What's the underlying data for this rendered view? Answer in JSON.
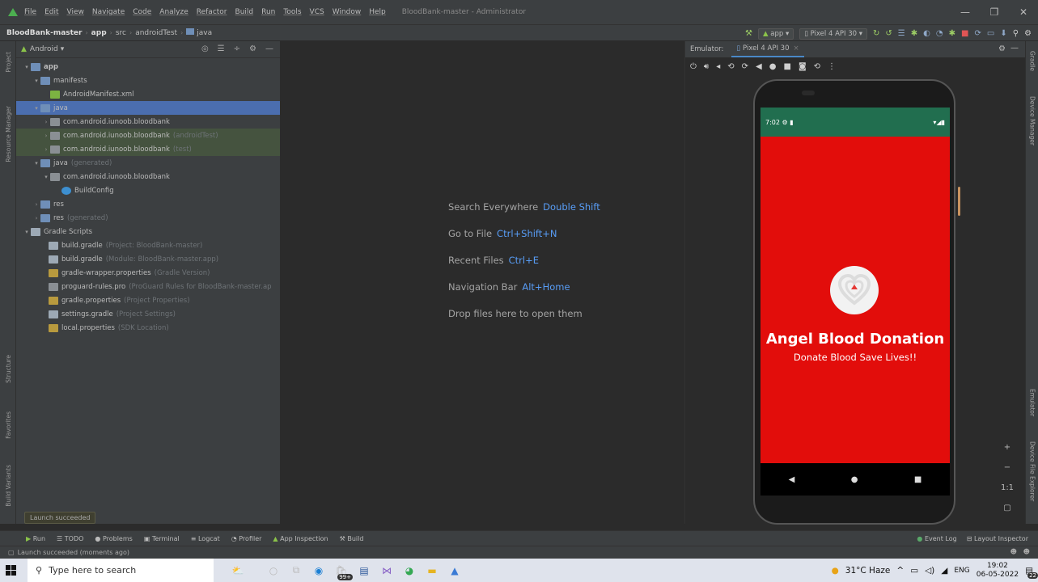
{
  "menubar": {
    "items": [
      "File",
      "Edit",
      "View",
      "Navigate",
      "Code",
      "Analyze",
      "Refactor",
      "Build",
      "Run",
      "Tools",
      "VCS",
      "Window",
      "Help"
    ],
    "window_title": "BloodBank-master - Administrator",
    "controls": [
      "—",
      "❐",
      "✕"
    ]
  },
  "navbar": {
    "breadcrumbs": [
      "BloodBank-master",
      "app",
      "src",
      "androidTest",
      "java"
    ],
    "run_config": "app",
    "device": "Pixel 4 API 30"
  },
  "sidebar_left": {
    "tabs": [
      "Project",
      "Resource Manager",
      "Structure",
      "Favorites",
      "Build Variants"
    ]
  },
  "project": {
    "view_selector": "Android",
    "tree": [
      {
        "label": "app",
        "hint": ""
      },
      {
        "label": "manifests",
        "hint": ""
      },
      {
        "label": "AndroidManifest.xml",
        "hint": ""
      },
      {
        "label": "java",
        "hint": ""
      },
      {
        "label": "com.android.iunoob.bloodbank",
        "hint": ""
      },
      {
        "label": "com.android.iunoob.bloodbank",
        "hint": "(androidTest)"
      },
      {
        "label": "com.android.iunoob.bloodbank",
        "hint": "(test)"
      },
      {
        "label": "java",
        "hint": "(generated)"
      },
      {
        "label": "com.android.iunoob.bloodbank",
        "hint": ""
      },
      {
        "label": "BuildConfig",
        "hint": ""
      },
      {
        "label": "res",
        "hint": ""
      },
      {
        "label": "res",
        "hint": "(generated)"
      },
      {
        "label": "Gradle Scripts",
        "hint": ""
      },
      {
        "label": "build.gradle",
        "hint": "(Project: BloodBank-master)"
      },
      {
        "label": "build.gradle",
        "hint": "(Module: BloodBank-master.app)"
      },
      {
        "label": "gradle-wrapper.properties",
        "hint": "(Gradle Version)"
      },
      {
        "label": "proguard-rules.pro",
        "hint": "(ProGuard Rules for BloodBank-master.ap"
      },
      {
        "label": "gradle.properties",
        "hint": "(Project Properties)"
      },
      {
        "label": "settings.gradle",
        "hint": "(Project Settings)"
      },
      {
        "label": "local.properties",
        "hint": "(SDK Location)"
      }
    ]
  },
  "editor": {
    "hints": [
      {
        "label": "Search Everywhere",
        "shortcut": "Double Shift"
      },
      {
        "label": "Go to File",
        "shortcut": "Ctrl+Shift+N"
      },
      {
        "label": "Recent Files",
        "shortcut": "Ctrl+E"
      },
      {
        "label": "Navigation Bar",
        "shortcut": "Alt+Home"
      },
      {
        "label": "Drop files here to open them",
        "shortcut": ""
      }
    ]
  },
  "emulator": {
    "label": "Emulator:",
    "tab": "Pixel 4 API 30",
    "zoom_controls": [
      "+",
      "−",
      "1:1",
      "▢"
    ]
  },
  "phone": {
    "time": "7:02",
    "app_title": "Angel Blood Donation",
    "app_subtitle": "Donate Blood Save Lives!!",
    "colors": {
      "status": "#216e4f",
      "body": "#e20d0b"
    }
  },
  "sidebar_right": {
    "tabs": [
      "Gradle",
      "Device Manager",
      "Emulator",
      "Device File Explorer"
    ]
  },
  "toast": "Launch succeeded",
  "bottom_tabs": [
    "Run",
    "TODO",
    "Problems",
    "Terminal",
    "Logcat",
    "Profiler",
    "App Inspection",
    "Build"
  ],
  "bottom_right": [
    "Event Log",
    "Layout Inspector"
  ],
  "status_text": "Launch succeeded (moments ago)",
  "taskbar": {
    "search_placeholder": "Type here to search",
    "badge": "99+",
    "weather": "31°C Haze",
    "lang": "ENG",
    "time": "19:02",
    "date": "06-05-2022",
    "notif": "22"
  }
}
